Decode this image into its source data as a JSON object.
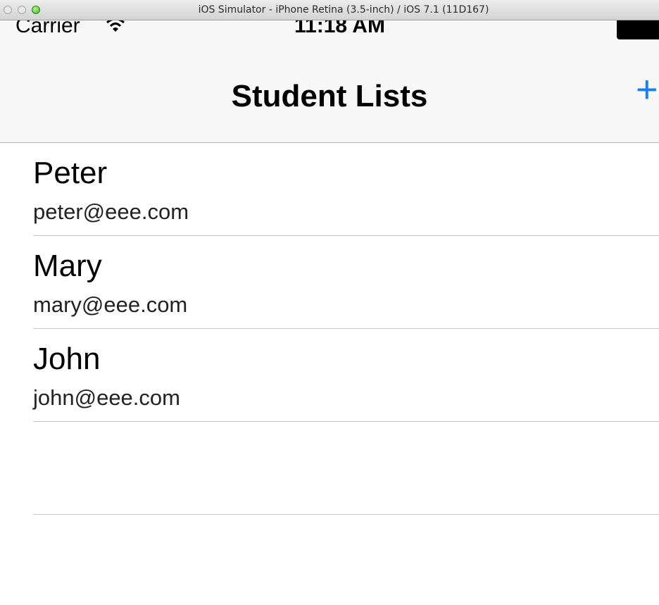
{
  "window": {
    "title": "iOS Simulator - iPhone Retina (3.5-inch) / iOS 7.1 (11D167)"
  },
  "status_bar": {
    "carrier": "Carrier",
    "time": "11:18 AM",
    "icons": [
      "wifi-icon",
      "battery-icon"
    ]
  },
  "nav": {
    "title": "Student Lists",
    "add_label": "+",
    "accent_color": "#1a7cf5"
  },
  "students": [
    {
      "name": "Peter",
      "email": "peter@eee.com"
    },
    {
      "name": "Mary",
      "email": "mary@eee.com"
    },
    {
      "name": "John",
      "email": "john@eee.com"
    }
  ]
}
